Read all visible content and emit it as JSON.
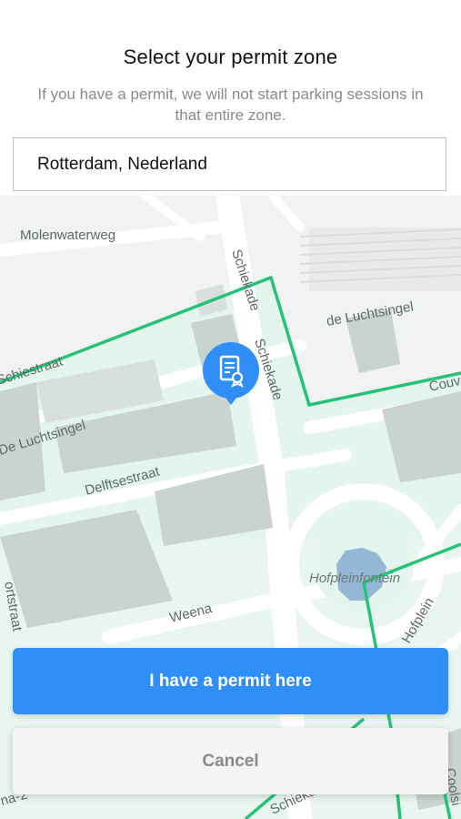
{
  "header": {
    "title": "Select your permit zone",
    "subtitle": "If you have a permit, we will not start parking sessions in that entire zone."
  },
  "search": {
    "value": "Rotterdam, Nederland"
  },
  "map": {
    "streets": {
      "molenwaterweg": "Molenwaterweg",
      "schiekade_1": "Schiekade",
      "schiekade_2": "Schiekade",
      "de_luchtsingel_1": "de Luchtsingel",
      "de_luchtsingel_2": "De Luchtsingel",
      "schiestraat": "Schiestraat",
      "delftsestraat": "Delftsestraat",
      "weena": "Weena",
      "hofpleinfontein": "Hofpleinfontein",
      "hofplein": "Hofplein",
      "couvert": "Couv",
      "portstraat": "ortstraat",
      "coolsingel": "Coolsi",
      "schiekade_bottom": "Schiekade",
      "bottom_left": "na-2"
    },
    "colors": {
      "zone_border": "#27c27a",
      "zone_fill": "#e6f5ee",
      "pin": "#2f8ef7"
    },
    "pin_icon": "permit-document-icon"
  },
  "actions": {
    "primary_label": "I have a permit here",
    "secondary_label": "Cancel"
  }
}
